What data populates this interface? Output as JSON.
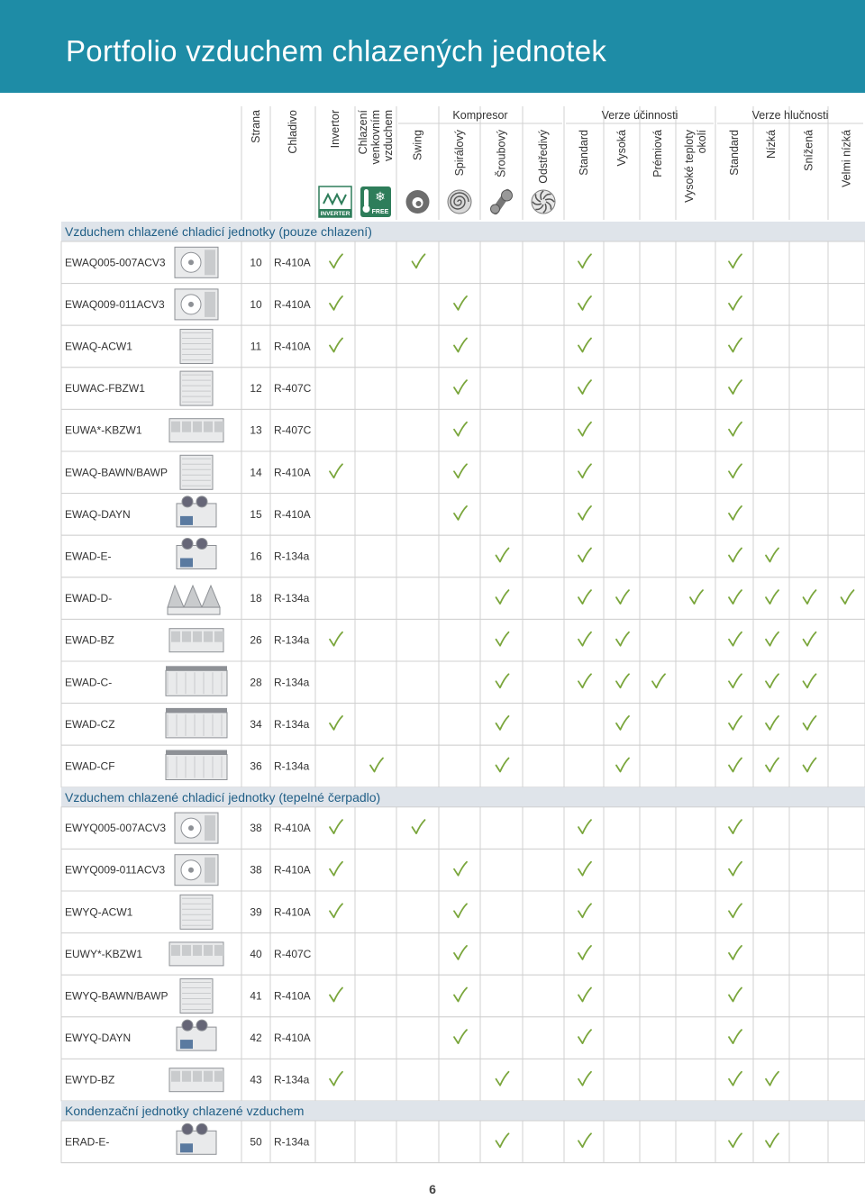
{
  "title": "Portfolio vzduchem chlazených jednotek",
  "page_number": "6",
  "colors": {
    "accent": "#1e8ca6",
    "section_bg": "#dfe4ea",
    "check": "#7aa63c",
    "grid": "#d0d0d0"
  },
  "header": {
    "columns": [
      {
        "id": "strana",
        "label": [
          "Strana"
        ]
      },
      {
        "id": "chladivo",
        "label": [
          "Chladivo"
        ]
      },
      {
        "id": "invertor",
        "label": [
          "Invertor"
        ],
        "icon": "inverter-icon",
        "icon_text": "INVERTER"
      },
      {
        "id": "free",
        "label": [
          "Chlazení",
          "venkovním",
          "vzduchem"
        ],
        "icon": "free-cooling-icon",
        "icon_text": "FREE"
      },
      {
        "id": "swing",
        "label": [
          "Swing"
        ],
        "icon": "swing-compressor-icon"
      },
      {
        "id": "spiral",
        "label": [
          "Spirálový"
        ],
        "icon": "scroll-compressor-icon"
      },
      {
        "id": "sroub",
        "label": [
          "Šroubový"
        ],
        "icon": "screw-compressor-icon"
      },
      {
        "id": "odstred",
        "label": [
          "Odstředivý"
        ],
        "icon": "centrifugal-compressor-icon"
      },
      {
        "id": "std",
        "label": [
          "Standard"
        ]
      },
      {
        "id": "vysoka",
        "label": [
          "Vysoká"
        ]
      },
      {
        "id": "premiova",
        "label": [
          "Prémiová"
        ]
      },
      {
        "id": "vysokeokoli",
        "label": [
          "Vysoké teploty",
          "okolí"
        ]
      },
      {
        "id": "hstd",
        "label": [
          "Standard"
        ]
      },
      {
        "id": "nizka",
        "label": [
          "Nízká"
        ]
      },
      {
        "id": "snizena",
        "label": [
          "Snížená"
        ]
      },
      {
        "id": "velminizka",
        "label": [
          "Velmi nízká"
        ]
      }
    ],
    "groups": [
      {
        "label": "Kompresor"
      },
      {
        "label": "Verze účinnosti"
      },
      {
        "label": "Verze hlučnosti"
      }
    ]
  },
  "sections": [
    {
      "title": "Vzduchem chlazené chladicí jednotky (pouze chlazení)",
      "rows": [
        {
          "model": "EWAQ005-007ACV3",
          "page": "10",
          "refrigerant": "R-410A",
          "unit": "small",
          "checks": [
            2,
            4,
            8,
            12
          ]
        },
        {
          "model": "EWAQ009-011ACV3",
          "page": "10",
          "refrigerant": "R-410A",
          "unit": "small2",
          "checks": [
            2,
            5,
            8,
            12
          ]
        },
        {
          "model": "EWAQ-ACW1",
          "page": "11",
          "refrigerant": "R-410A",
          "unit": "box",
          "checks": [
            2,
            5,
            8,
            12
          ]
        },
        {
          "model": "EUWAC-FBZW1",
          "page": "12",
          "refrigerant": "R-407C",
          "unit": "box",
          "checks": [
            5,
            8,
            12
          ]
        },
        {
          "model": "EUWA*-KBZW1",
          "page": "13",
          "refrigerant": "R-407C",
          "unit": "wide",
          "checks": [
            5,
            8,
            12
          ]
        },
        {
          "model": "EWAQ-BAWN/BAWP",
          "page": "14",
          "refrigerant": "R-410A",
          "unit": "box",
          "checks": [
            2,
            5,
            8,
            12
          ]
        },
        {
          "model": "EWAQ-DAYN",
          "page": "15",
          "refrigerant": "R-410A",
          "unit": "fans",
          "checks": [
            5,
            8,
            12
          ]
        },
        {
          "model": "EWAD-E-",
          "page": "16",
          "refrigerant": "R-134a",
          "unit": "fans",
          "checks": [
            6,
            8,
            12,
            13
          ]
        },
        {
          "model": "EWAD-D-",
          "page": "18",
          "refrigerant": "R-134a",
          "unit": "vshape",
          "checks": [
            6,
            8,
            9,
            11,
            12,
            13,
            14,
            15
          ]
        },
        {
          "model": "EWAD-BZ",
          "page": "26",
          "refrigerant": "R-134a",
          "unit": "wide",
          "checks": [
            2,
            6,
            8,
            9,
            12,
            13,
            14
          ]
        },
        {
          "model": "EWAD-C-",
          "page": "28",
          "refrigerant": "R-134a",
          "unit": "long",
          "checks": [
            6,
            8,
            9,
            10,
            12,
            13,
            14
          ]
        },
        {
          "model": "EWAD-CZ",
          "page": "34",
          "refrigerant": "R-134a",
          "unit": "long",
          "checks": [
            2,
            6,
            9,
            12,
            13,
            14
          ]
        },
        {
          "model": "EWAD-CF",
          "page": "36",
          "refrigerant": "R-134a",
          "unit": "long",
          "checks": [
            3,
            6,
            9,
            12,
            13,
            14
          ]
        }
      ]
    },
    {
      "title": "Vzduchem chlazené chladicí jednotky (tepelné čerpadlo)",
      "rows": [
        {
          "model": "EWYQ005-007ACV3",
          "page": "38",
          "refrigerant": "R-410A",
          "unit": "small",
          "checks": [
            2,
            4,
            8,
            12
          ]
        },
        {
          "model": "EWYQ009-011ACV3",
          "page": "38",
          "refrigerant": "R-410A",
          "unit": "small2",
          "checks": [
            2,
            5,
            8,
            12
          ]
        },
        {
          "model": "EWYQ-ACW1",
          "page": "39",
          "refrigerant": "R-410A",
          "unit": "box",
          "checks": [
            2,
            5,
            8,
            12
          ]
        },
        {
          "model": "EUWY*-KBZW1",
          "page": "40",
          "refrigerant": "R-407C",
          "unit": "wide",
          "checks": [
            5,
            8,
            12
          ]
        },
        {
          "model": "EWYQ-BAWN/BAWP",
          "page": "41",
          "refrigerant": "R-410A",
          "unit": "box",
          "checks": [
            2,
            5,
            8,
            12
          ]
        },
        {
          "model": "EWYQ-DAYN",
          "page": "42",
          "refrigerant": "R-410A",
          "unit": "fans",
          "checks": [
            5,
            8,
            12
          ]
        },
        {
          "model": "EWYD-BZ",
          "page": "43",
          "refrigerant": "R-134a",
          "unit": "wide",
          "checks": [
            2,
            6,
            8,
            12,
            13
          ]
        }
      ]
    },
    {
      "title": "Kondenzační jednotky chlazené vzduchem",
      "rows": [
        {
          "model": "ERAD-E-",
          "page": "50",
          "refrigerant": "R-134a",
          "unit": "fans",
          "checks": [
            6,
            8,
            12,
            13
          ]
        }
      ]
    }
  ]
}
